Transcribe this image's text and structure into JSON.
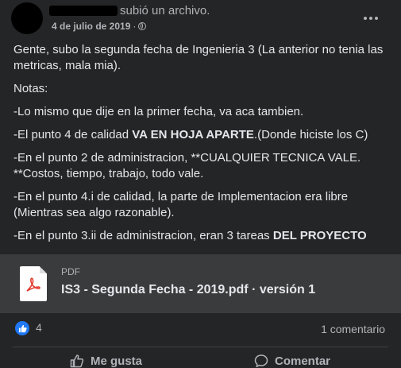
{
  "header": {
    "action_text": "subió un archivo.",
    "date": "4 de julio de 2019",
    "separator": "·",
    "privacy_icon": "globe-icon",
    "more_icon": "more-dots-icon"
  },
  "post": {
    "paragraphs": [
      [
        {
          "text": "Gente, subo la segunda fecha de Ingenieria 3 (La anterior no tenia las metricas, mala mia)."
        }
      ],
      [
        {
          "text": "Notas:"
        }
      ],
      [
        {
          "text": "-Lo mismo que dije en la primer fecha, va aca tambien."
        }
      ],
      [
        {
          "text": "-El punto 4 de calidad "
        },
        {
          "text": "VA EN HOJA APARTE",
          "bold": true
        },
        {
          "text": ".(Donde hiciste los C)"
        }
      ],
      [
        {
          "text": "-En el punto 2 de administracion, **CUALQUIER TECNICA VALE. **Costos, tiempo, trabajo, todo vale."
        }
      ],
      [
        {
          "text": "-En el punto 4.i de calidad, la parte de Implementacion era libre (Mientras sea algo razonable)."
        }
      ],
      [
        {
          "text": "-En el punto 3.ii de administracion, eran 3 tareas "
        },
        {
          "text": "DEL PROYECTO",
          "bold": true
        }
      ]
    ]
  },
  "attachment": {
    "type": "PDF",
    "file_name": "IS3 - Segunda Fecha - 2019.pdf · versión 1",
    "icon": "pdf-file-icon",
    "icon_color": "#e03c31"
  },
  "reactions": {
    "like_count": "4",
    "comments": "1 comentario",
    "like_color": "#2078f4"
  },
  "actions": {
    "like_label": "Me gusta",
    "comment_label": "Comentar"
  }
}
